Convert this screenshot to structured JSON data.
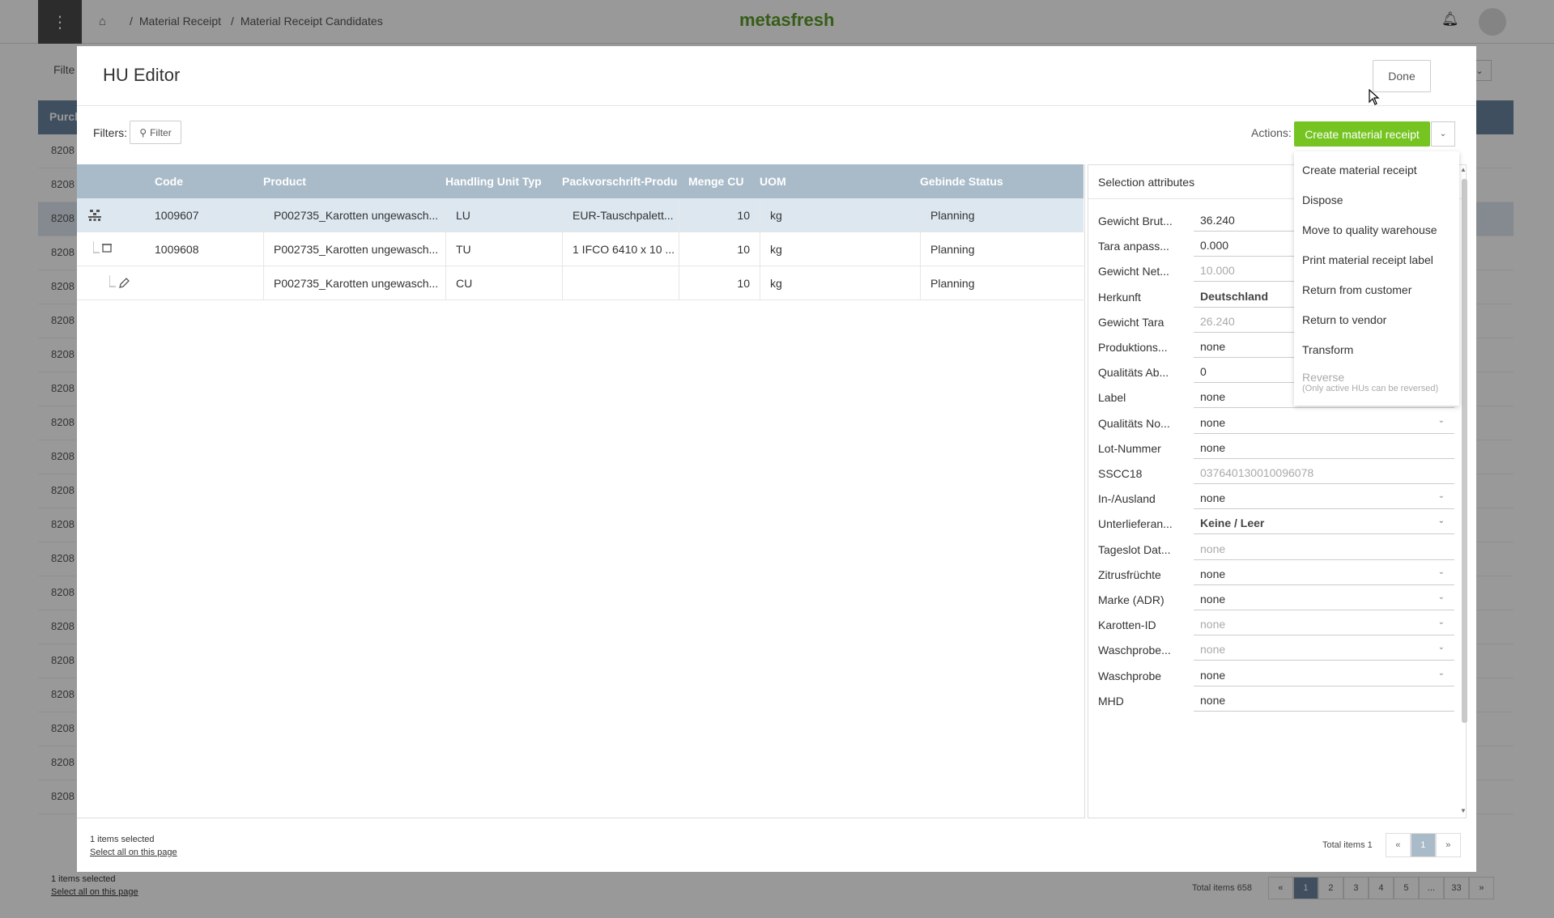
{
  "app": {
    "logo": "metasfresh",
    "breadcrumb": [
      "Material Receipt",
      "Material Receipt Candidates"
    ],
    "bg_filter_label": "Filte",
    "bg_column_label": "Purch",
    "bg_rows": [
      "8208",
      "8208",
      "8208",
      "8208",
      "8208",
      "8208",
      "8208",
      "8208",
      "8208",
      "8208",
      "8208",
      "8208",
      "8208",
      "8208",
      "8208",
      "8208",
      "8208",
      "8208",
      "8208",
      "8208"
    ],
    "bg_footer": {
      "selected": "1 items selected",
      "select_all": "Select all on this page"
    },
    "bg_pager": {
      "total": "Total items 658",
      "prev": "«",
      "pages": [
        "1",
        "2",
        "3",
        "4",
        "5",
        "...",
        "33"
      ],
      "next": "»"
    }
  },
  "modal": {
    "title": "HU Editor",
    "done_label": "Done",
    "filters_label": "Filters:",
    "filter_button": "Filter",
    "actions_label": "Actions:",
    "create_button": "Create material receipt",
    "table": {
      "columns": [
        "Code",
        "Product",
        "Handling Unit Typ",
        "Packvorschrift-Produ",
        "Menge CU",
        "UOM",
        "Gebinde Status"
      ],
      "rows": [
        {
          "icon": "pallet-icon",
          "code": "1009607",
          "product": "P002735_Karotten ungewasch...",
          "hutype": "LU",
          "pack": "EUR-Tauschpalett...",
          "menge": "10",
          "uom": "kg",
          "status": "Planning"
        },
        {
          "icon": "box-icon",
          "code": "1009608",
          "product": "P002735_Karotten ungewasch...",
          "hutype": "TU",
          "pack": "1 IFCO 6410 x 10 ...",
          "menge": "10",
          "uom": "kg",
          "status": "Planning"
        },
        {
          "icon": "pencil-icon",
          "code": "",
          "product": "P002735_Karotten ungewasch...",
          "hutype": "CU",
          "pack": "",
          "menge": "10",
          "uom": "kg",
          "status": "Planning"
        }
      ]
    },
    "attributes": {
      "title": "Selection attributes",
      "items": [
        {
          "label": "Gewicht Brut...",
          "value": "36.240"
        },
        {
          "label": "Tara anpass...",
          "value": "0.000"
        },
        {
          "label": "Gewicht Net...",
          "value": "10.000"
        },
        {
          "label": "Herkunft",
          "value": "Deutschland"
        },
        {
          "label": "Gewicht Tara",
          "value": "26.240"
        },
        {
          "label": "Produktions...",
          "value": "none"
        },
        {
          "label": "Qualitäts Ab...",
          "value": "0"
        },
        {
          "label": "Label",
          "value": "none"
        },
        {
          "label": "Qualitäts No...",
          "value": "none"
        },
        {
          "label": "Lot-Nummer",
          "value": "none"
        },
        {
          "label": "SSCC18",
          "value": "037640130010096078"
        },
        {
          "label": "In-/Ausland",
          "value": "none"
        },
        {
          "label": "Unterlieferan...",
          "value": "Keine / Leer"
        },
        {
          "label": "Tageslot Dat...",
          "value": "none"
        },
        {
          "label": "Zitrusfrüchte",
          "value": "none"
        },
        {
          "label": "Marke (ADR)",
          "value": "none"
        },
        {
          "label": "Karotten-ID",
          "value": "none"
        },
        {
          "label": "Waschprobe...",
          "value": "none"
        },
        {
          "label": "Waschprobe",
          "value": "none"
        },
        {
          "label": "MHD",
          "value": "none"
        }
      ]
    },
    "actions_menu": {
      "items": [
        "Create material receipt",
        "Dispose",
        "Move to quality warehouse",
        "Print material receipt label",
        "Return from customer",
        "Return to vendor",
        "Transform"
      ],
      "disabled_item": "Reverse",
      "disabled_note": "(Only active HUs can be reversed)"
    },
    "footer": {
      "selected": "1 items selected",
      "select_all": "Select all on this page",
      "total": "Total items 1",
      "prev": "«",
      "page": "1",
      "next": "»"
    }
  }
}
